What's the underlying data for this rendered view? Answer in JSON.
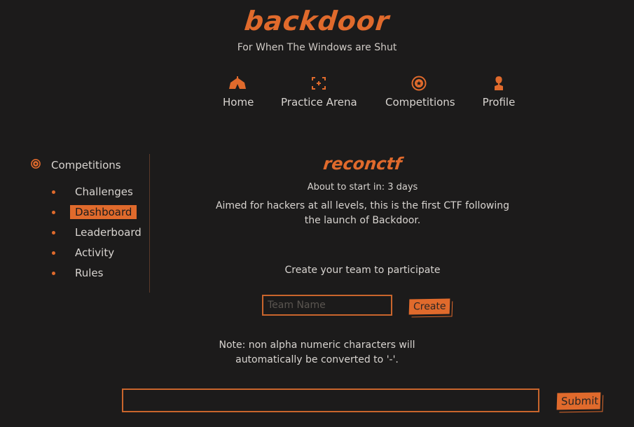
{
  "header": {
    "logo": "backdoor",
    "tagline": "For When The Windows are Shut"
  },
  "nav": [
    {
      "label": "Home",
      "icon": "circus-tent-icon"
    },
    {
      "label": "Practice Arena",
      "icon": "crosshair-icon"
    },
    {
      "label": "Competitions",
      "icon": "star-badge-icon"
    },
    {
      "label": "Profile",
      "icon": "user-icon"
    }
  ],
  "sidebar": {
    "title": "Competitions",
    "items": [
      {
        "label": "Challenges",
        "active": false
      },
      {
        "label": "Dashboard",
        "active": true
      },
      {
        "label": "Leaderboard",
        "active": false
      },
      {
        "label": "Activity",
        "active": false
      },
      {
        "label": "Rules",
        "active": false
      }
    ]
  },
  "competition": {
    "title": "reconctf",
    "start_info": "About to start in: 3 days",
    "description": "Aimed for hackers at all levels, this is the first CTF following the launch of Backdoor.",
    "create_prompt": "Create your team to participate"
  },
  "team_form": {
    "placeholder": "Team Name",
    "value": "",
    "button": "Create"
  },
  "note": {
    "line1": "Note: non alpha numeric characters will",
    "line2": "automatically be converted to '-'."
  },
  "flag_form": {
    "value": "",
    "button": "Submit"
  },
  "colors": {
    "background": "#1c1b1b",
    "accent": "#e06a2c",
    "text": "#d8d4d0"
  }
}
